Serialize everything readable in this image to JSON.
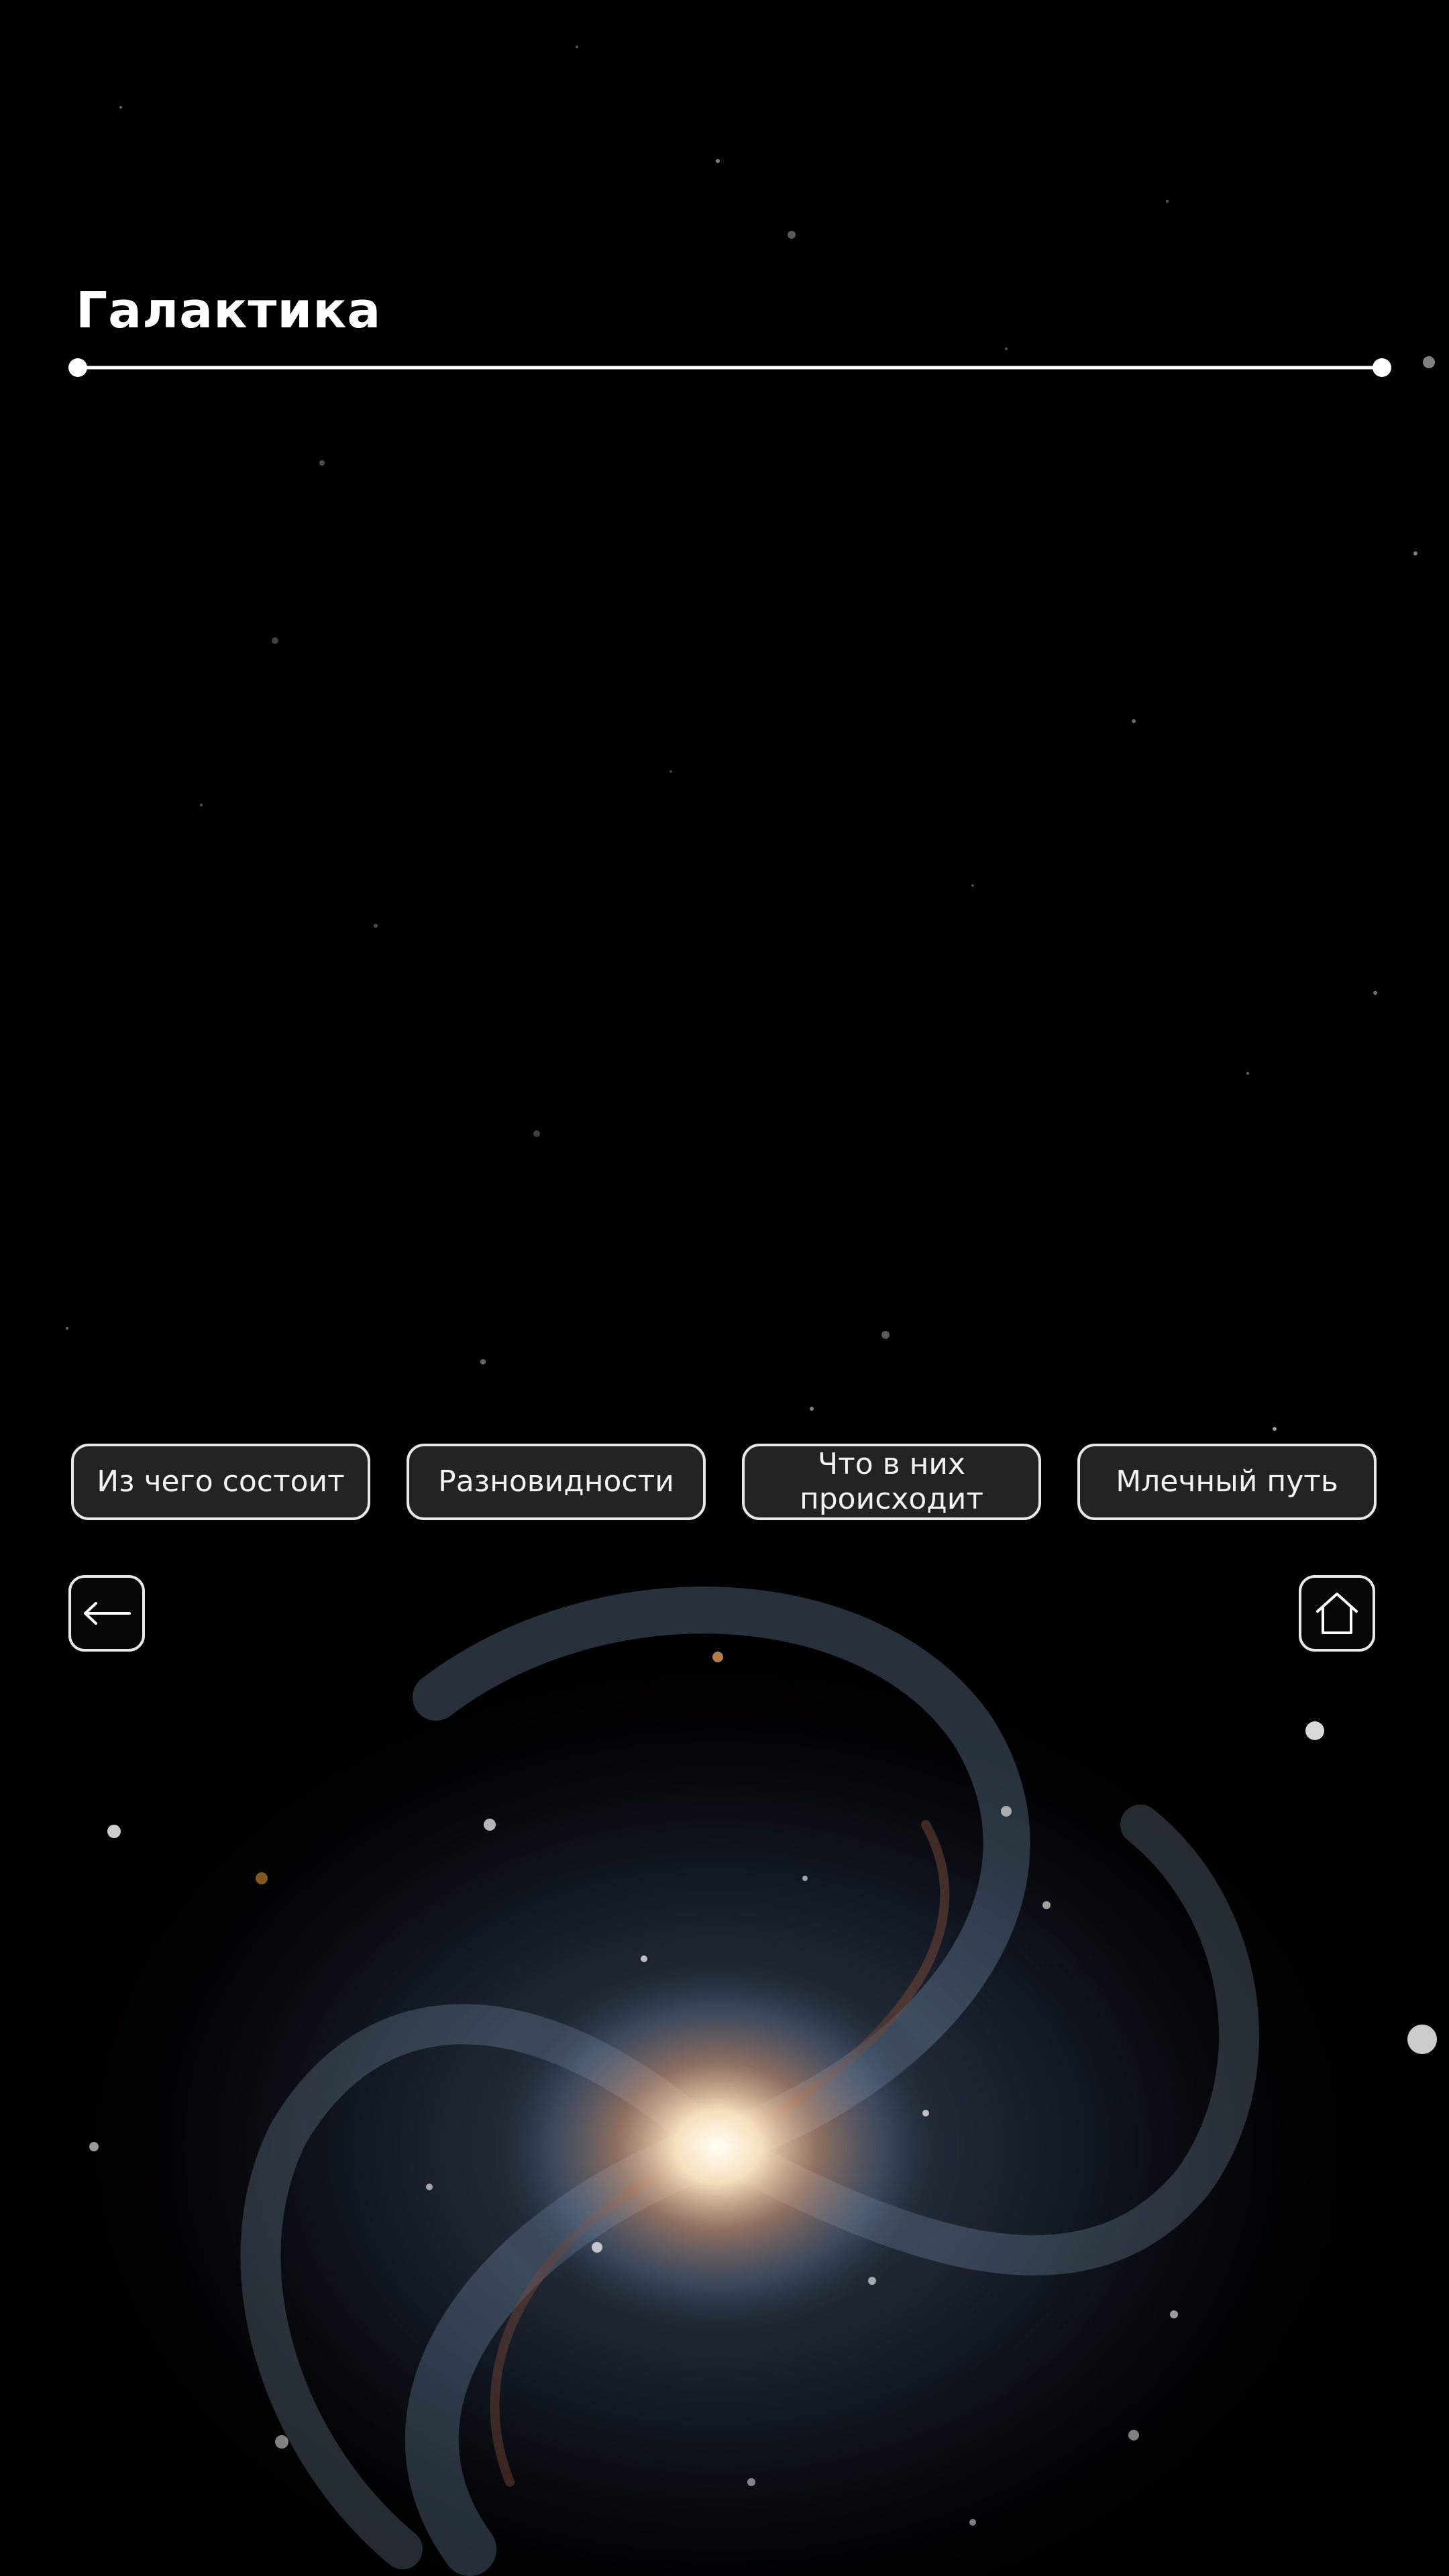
{
  "header": {
    "title": "Галактика"
  },
  "nav": {
    "items": [
      {
        "label": "Из чего состоит"
      },
      {
        "label": "Разновидности"
      },
      {
        "label": "Что в них происходит"
      },
      {
        "label": "Млечный путь"
      }
    ]
  },
  "controls": {
    "back_icon": "arrow-left-icon",
    "home_icon": "home-icon"
  },
  "theme": {
    "background": "#000000",
    "text": "#ffffff",
    "button_border": "#e8e8e8",
    "button_fill": "#282828"
  }
}
